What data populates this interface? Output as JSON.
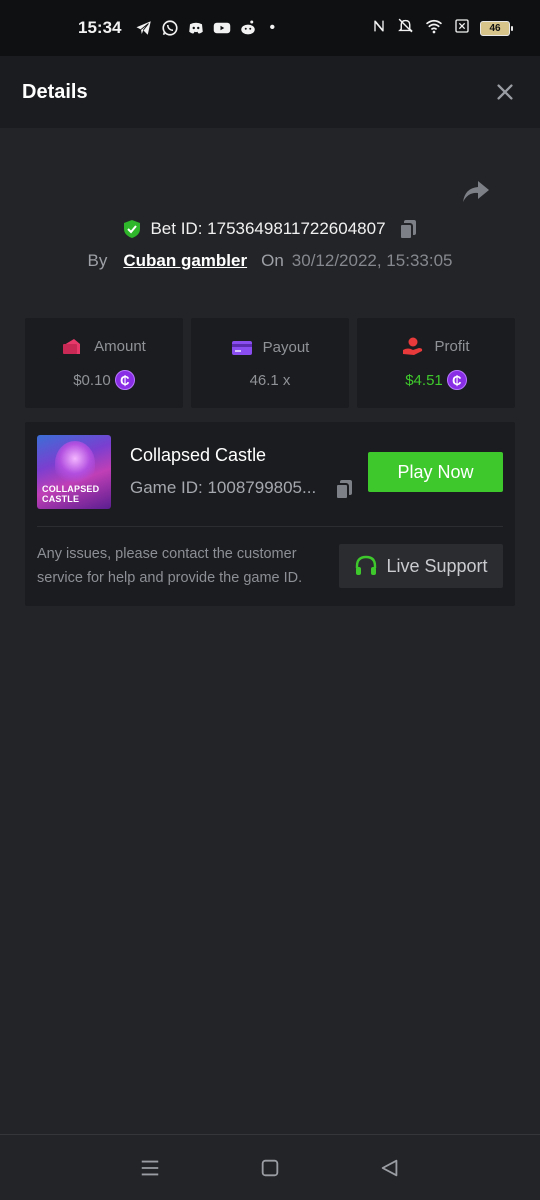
{
  "status_bar": {
    "time": "15:34",
    "notification_icons": [
      "telegram-icon",
      "whatsapp-icon",
      "discord-icon",
      "youtube-icon",
      "reddit-icon"
    ],
    "dot": "•",
    "battery_level": "46"
  },
  "header": {
    "title": "Details",
    "close_icon": "close-icon"
  },
  "bet": {
    "id_label": "Bet ID: 1753649811722604807",
    "by_label": "By",
    "user": "Cuban gambler",
    "on_label": "On",
    "date": "30/12/2022, 15:33:05"
  },
  "stats": {
    "amount": {
      "label": "Amount",
      "value": "$0.10",
      "color": "#e83a6a"
    },
    "payout": {
      "label": "Payout",
      "value": "46.1 x",
      "color": "#8a4df0"
    },
    "profit": {
      "label": "Profit",
      "value": "$4.51",
      "color": "#e83a3a",
      "value_color": "#3ec82c"
    }
  },
  "coin_symbol": "₵",
  "game": {
    "thumb_line1": "COLLAPSED",
    "thumb_line2": "CASTLE",
    "name": "Collapsed Castle",
    "id_label": "Game ID: 1008799805...",
    "play_label": "Play Now",
    "note": "Any issues, please contact the customer service for help and provide the game ID.",
    "support_label": "Live Support"
  },
  "colors": {
    "accent_green": "#3ec82c",
    "background": "#232427",
    "card": "#1b1c1f"
  }
}
